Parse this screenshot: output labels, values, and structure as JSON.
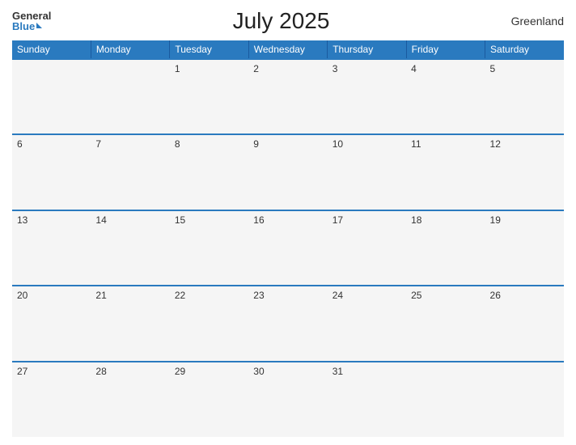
{
  "header": {
    "logo_general": "General",
    "logo_blue": "Blue",
    "title": "July 2025",
    "region": "Greenland"
  },
  "weekdays": [
    "Sunday",
    "Monday",
    "Tuesday",
    "Wednesday",
    "Thursday",
    "Friday",
    "Saturday"
  ],
  "weeks": [
    [
      {
        "day": "",
        "empty": true
      },
      {
        "day": "",
        "empty": true
      },
      {
        "day": "1",
        "empty": false
      },
      {
        "day": "2",
        "empty": false
      },
      {
        "day": "3",
        "empty": false
      },
      {
        "day": "4",
        "empty": false
      },
      {
        "day": "5",
        "empty": false
      }
    ],
    [
      {
        "day": "6",
        "empty": false
      },
      {
        "day": "7",
        "empty": false
      },
      {
        "day": "8",
        "empty": false
      },
      {
        "day": "9",
        "empty": false
      },
      {
        "day": "10",
        "empty": false
      },
      {
        "day": "11",
        "empty": false
      },
      {
        "day": "12",
        "empty": false
      }
    ],
    [
      {
        "day": "13",
        "empty": false
      },
      {
        "day": "14",
        "empty": false
      },
      {
        "day": "15",
        "empty": false
      },
      {
        "day": "16",
        "empty": false
      },
      {
        "day": "17",
        "empty": false
      },
      {
        "day": "18",
        "empty": false
      },
      {
        "day": "19",
        "empty": false
      }
    ],
    [
      {
        "day": "20",
        "empty": false
      },
      {
        "day": "21",
        "empty": false
      },
      {
        "day": "22",
        "empty": false
      },
      {
        "day": "23",
        "empty": false
      },
      {
        "day": "24",
        "empty": false
      },
      {
        "day": "25",
        "empty": false
      },
      {
        "day": "26",
        "empty": false
      }
    ],
    [
      {
        "day": "27",
        "empty": false
      },
      {
        "day": "28",
        "empty": false
      },
      {
        "day": "29",
        "empty": false
      },
      {
        "day": "30",
        "empty": false
      },
      {
        "day": "31",
        "empty": false
      },
      {
        "day": "",
        "empty": true
      },
      {
        "day": "",
        "empty": true
      }
    ]
  ]
}
